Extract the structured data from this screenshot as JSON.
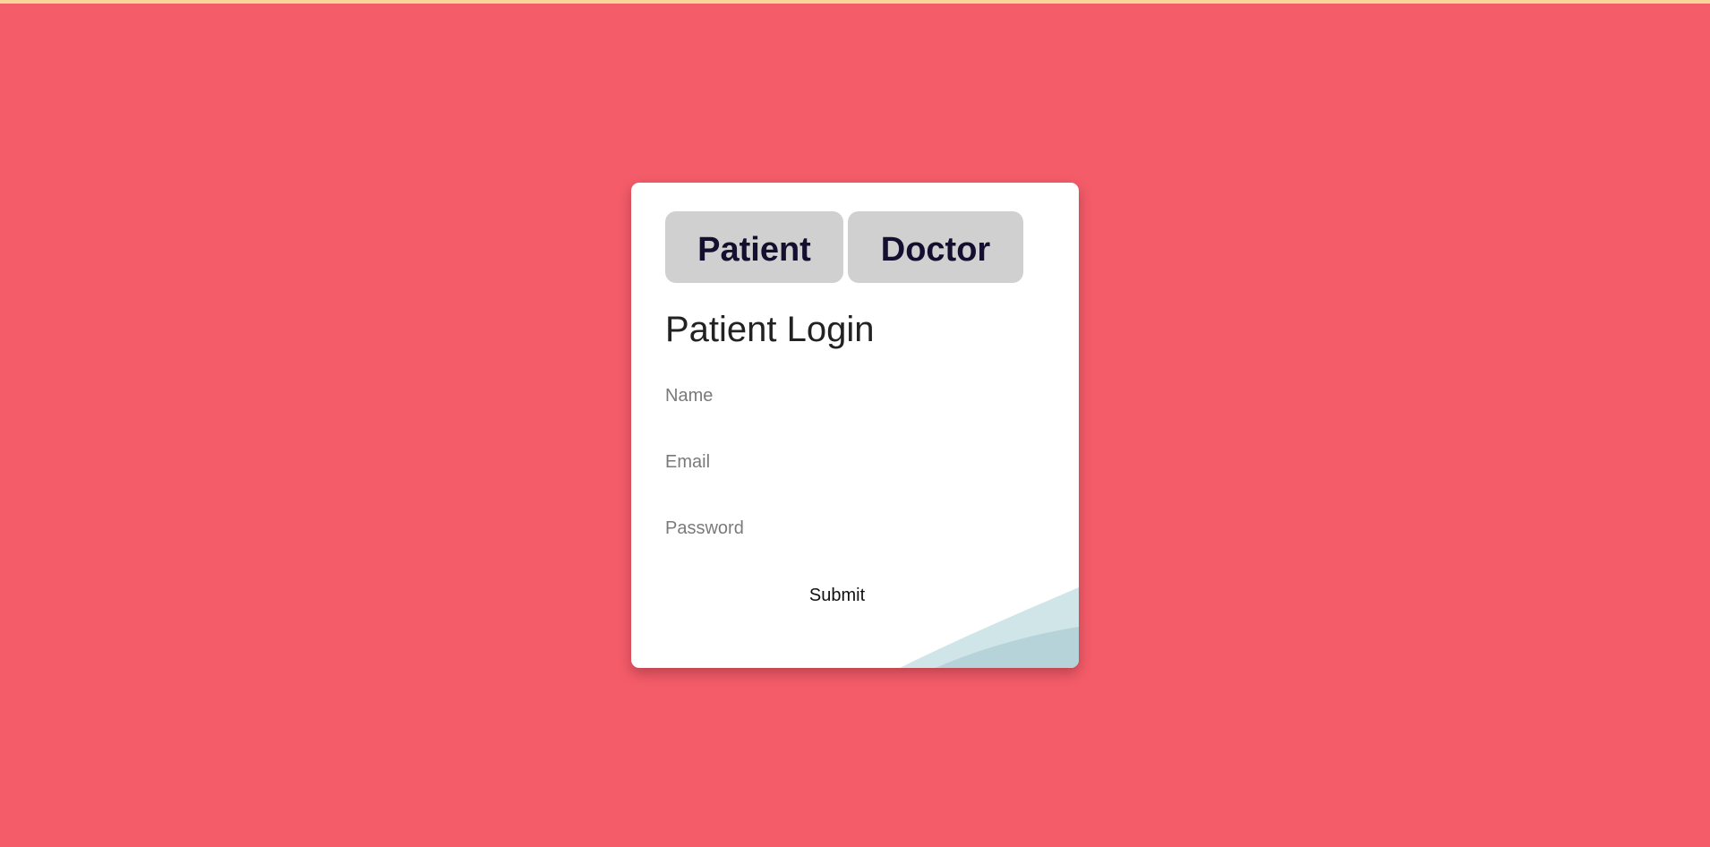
{
  "colors": {
    "background": "#f45c69",
    "card": "#ffffff",
    "tab_bg": "#d0d0d0",
    "tab_text": "#140f2e",
    "wave_light": "#cfe5e8",
    "wave_dark": "#b5d3d9"
  },
  "tabs": [
    {
      "label": "Patient"
    },
    {
      "label": "Doctor"
    }
  ],
  "form": {
    "title": "Patient Login",
    "name_placeholder": "Name",
    "email_placeholder": "Email",
    "password_placeholder": "Password",
    "submit_label": "Submit"
  }
}
